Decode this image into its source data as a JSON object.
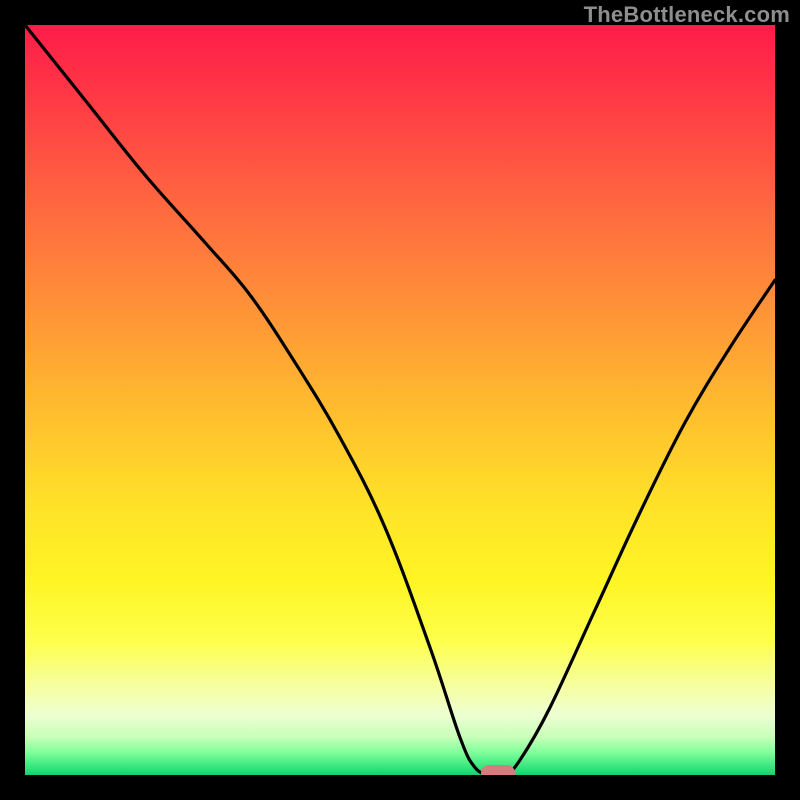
{
  "watermark": "TheBottleneck.com",
  "chart_data": {
    "type": "line",
    "title": "",
    "xlabel": "",
    "ylabel": "",
    "xlim": [
      0,
      100
    ],
    "ylim": [
      0,
      100
    ],
    "grid": false,
    "legend": false,
    "series": [
      {
        "name": "bottleneck-curve",
        "x": [
          0,
          8,
          16,
          24,
          30,
          36,
          42,
          48,
          54,
          58,
          60,
          62,
          64,
          66,
          70,
          76,
          82,
          88,
          94,
          100
        ],
        "y": [
          100,
          90,
          80,
          71,
          64,
          55,
          45,
          33,
          17,
          5,
          1,
          0,
          0,
          2,
          9,
          22,
          35,
          47,
          57,
          66
        ]
      }
    ],
    "marker": {
      "x": 63,
      "y": 0
    },
    "background": {
      "type": "vertical-gradient",
      "stops": [
        {
          "pos": 0.0,
          "color": "#ff1c49"
        },
        {
          "pos": 0.4,
          "color": "#ff9936"
        },
        {
          "pos": 0.74,
          "color": "#fff424"
        },
        {
          "pos": 0.92,
          "color": "#eeffd2"
        },
        {
          "pos": 1.0,
          "color": "#15cf6f"
        }
      ]
    }
  },
  "colors": {
    "frame": "#000000",
    "curve": "#000000",
    "marker": "#d87b7f",
    "watermark": "#8e8e8e"
  }
}
